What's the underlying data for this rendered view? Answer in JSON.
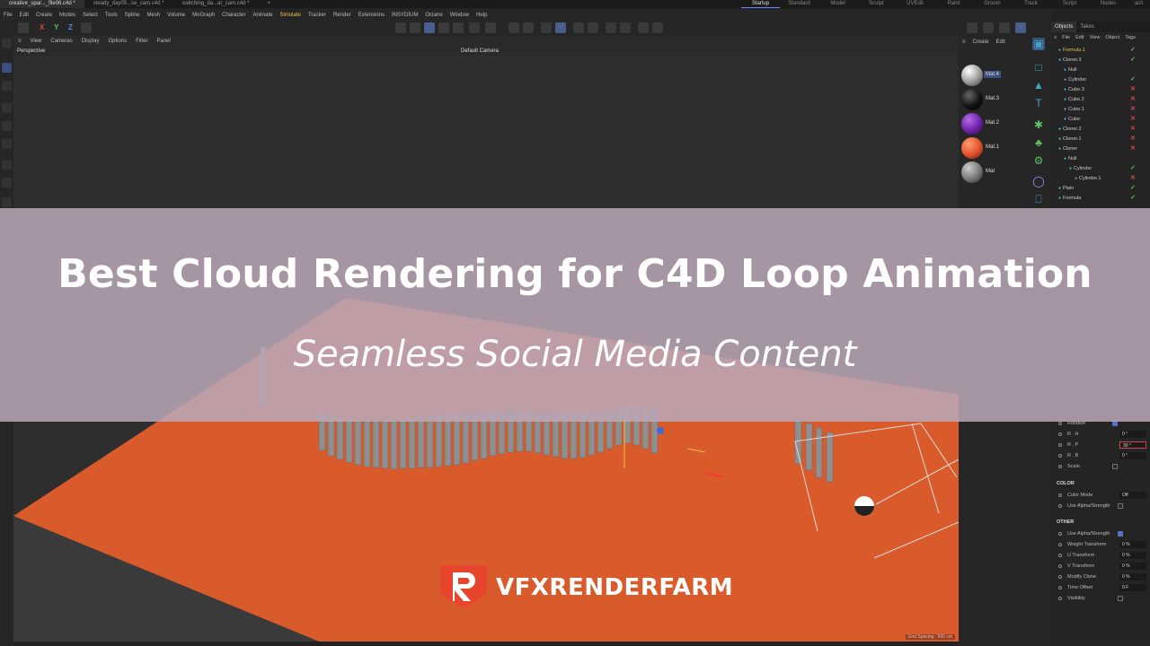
{
  "document_tabs": [
    "creative_spar..._file06.c4d *",
    "steady_day05...se_cam.c4d *",
    "switching_da...ar_cam.c4d *"
  ],
  "active_tab_index": 0,
  "layouts": [
    "Startup",
    "Standard",
    "Model",
    "Sculpt",
    "UVEdit",
    "Paint",
    "Groom",
    "Track",
    "Script",
    "Nodes",
    "acti"
  ],
  "menu": [
    "File",
    "Edit",
    "Create",
    "Modes",
    "Select",
    "Tools",
    "Spline",
    "Mesh",
    "Volume",
    "MoGraph",
    "Character",
    "Animate",
    "Simulate",
    "Tracker",
    "Render",
    "Extensions",
    "INSYDIUM",
    "Octane",
    "Window",
    "Help"
  ],
  "toolbar": {
    "axis_x": "X",
    "axis_y": "Y",
    "axis_z": "Z"
  },
  "viewport": {
    "menus": [
      "View",
      "Cameras",
      "Display",
      "Options",
      "Filter",
      "Panel"
    ],
    "view_name": "Perspective",
    "camera": "Default Camera",
    "grid_spacing": "Grid Spacing : 500 cm"
  },
  "materials": {
    "menus": [
      "Create",
      "Edit"
    ],
    "items": [
      {
        "name": "Mat.4",
        "color": "#d9d9d9",
        "selected": true
      },
      {
        "name": "Mat.3",
        "color": "#111111",
        "selected": false
      },
      {
        "name": "Mat.2",
        "color": "#6b22a6",
        "selected": false
      },
      {
        "name": "Mat.1",
        "color": "#e0522a",
        "selected": false
      },
      {
        "name": "Mat",
        "color": "#777777",
        "selected": false
      }
    ]
  },
  "panel_tabs": [
    "Objects",
    "Takes"
  ],
  "object_menus": [
    "File",
    "Edit",
    "View",
    "Object",
    "Tags"
  ],
  "objects": [
    {
      "name": "Formula.1",
      "indent": 0,
      "highlight": true,
      "flag": "check"
    },
    {
      "name": "Cloner.3",
      "indent": 0,
      "highlight": false,
      "flag": "check"
    },
    {
      "name": "Null",
      "indent": 1,
      "highlight": false,
      "flag": ""
    },
    {
      "name": "Cylinder",
      "indent": 1,
      "highlight": false,
      "flag": "check"
    },
    {
      "name": "Cube.3",
      "indent": 1,
      "highlight": false,
      "flag": "cross"
    },
    {
      "name": "Cube.2",
      "indent": 1,
      "highlight": false,
      "flag": "cross"
    },
    {
      "name": "Cube.1",
      "indent": 1,
      "highlight": false,
      "flag": "cross"
    },
    {
      "name": "Cube",
      "indent": 1,
      "highlight": false,
      "flag": "cross"
    },
    {
      "name": "Cloner.2",
      "indent": 0,
      "highlight": false,
      "flag": "cross"
    },
    {
      "name": "Cloner.1",
      "indent": 0,
      "highlight": false,
      "flag": "cross"
    },
    {
      "name": "Cloner",
      "indent": 0,
      "highlight": false,
      "flag": "cross"
    },
    {
      "name": "Null",
      "indent": 1,
      "highlight": false,
      "flag": ""
    },
    {
      "name": "Cylinder",
      "indent": 2,
      "highlight": false,
      "flag": "check"
    },
    {
      "name": "Cylinder.1",
      "indent": 3,
      "highlight": false,
      "flag": "cross"
    },
    {
      "name": "Plain",
      "indent": 0,
      "highlight": false,
      "flag": "check"
    },
    {
      "name": "Formula",
      "indent": 0,
      "highlight": false,
      "flag": "check"
    }
  ],
  "attributes": {
    "rotation": {
      "label": "Rotation",
      "checked": true
    },
    "rh": {
      "label": "R . H",
      "value": "0 °"
    },
    "rp": {
      "label": "R . P",
      "value": "30 °"
    },
    "rb": {
      "label": "R . B",
      "value": "0 °"
    },
    "scale": {
      "label": "Scale",
      "checked": false
    },
    "color_section": "COLOR",
    "color_mode": {
      "label": "Color Mode",
      "value": "Off"
    },
    "use_alpha_1": {
      "label": "Use Alpha/Strength",
      "checked": false
    },
    "other_section": "OTHER",
    "use_alpha_2": {
      "label": "Use Alpha/Strength",
      "checked": true
    },
    "weight": {
      "label": "Weight Transform",
      "value": "0 %"
    },
    "u_transform": {
      "label": "U Transform",
      "value": "0 %"
    },
    "v_transform": {
      "label": "V Transform",
      "value": "0 %"
    },
    "modify_clone": {
      "label": "Modify Clone",
      "value": "0 %"
    },
    "time_offset": {
      "label": "Time Offset",
      "value": "0 F"
    },
    "visibility": {
      "label": "Visibility",
      "checked": false
    }
  },
  "banner": {
    "title": "Best Cloud Rendering for C4D Loop Animation",
    "subtitle": "Seamless Social Media Content"
  },
  "logo": {
    "text": "VFXRENDERFARM",
    "brand_color": "#e8452f"
  },
  "colors": {
    "floor": "#d95a2b",
    "accent": "#5b8cff",
    "banner": "#baa8b8"
  }
}
